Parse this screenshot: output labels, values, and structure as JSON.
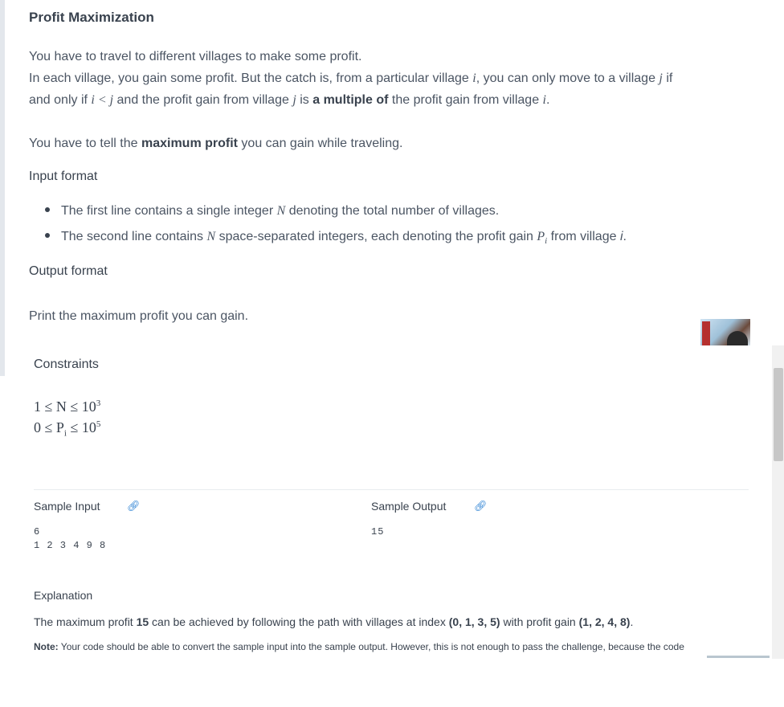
{
  "problem": {
    "title": "Profit Maximization",
    "intro_line1": "You have to travel to different villages to make some profit.",
    "intro_line2": {
      "a": "In each village, you gain some profit. But the catch is, from a particular village ",
      "i": "i",
      "b": ", you can only move to a village ",
      "j": "j",
      "c": " if"
    },
    "intro_line3": {
      "a": "and only if ",
      "math": "i < j",
      "b": " and the profit gain from village ",
      "j": "j",
      "c": " is ",
      "bold": "a multiple of",
      "d": " the profit gain from village ",
      "i": "i",
      "e": "."
    },
    "task_line": {
      "a": "You have to tell the ",
      "bold": "maximum profit",
      "b": " you can gain while traveling."
    },
    "input_heading": "Input format",
    "input_bullets": [
      {
        "a": "The first line contains a single integer ",
        "var": "N",
        "b": " denoting the total number of villages."
      },
      {
        "a": "The second line contains ",
        "var": "N",
        "b": " space-separated integers, each denoting the profit gain ",
        "var2": "P",
        "sub2": "i",
        "c": " from village ",
        "var3": "i",
        "d": "."
      }
    ],
    "output_heading": "Output format",
    "output_text": "Print the maximum profit you can gain.",
    "constraints_heading": "Constraints",
    "constraint1": {
      "lhs": "1 ≤ N ≤ 10",
      "exp": "3"
    },
    "constraint2": {
      "lhs_a": "0 ≤ P",
      "sub": "i",
      "lhs_b": " ≤ 10",
      "exp": "5"
    }
  },
  "samples": {
    "input_label": "Sample Input",
    "output_label": "Sample Output",
    "link_icon": "link-icon",
    "input_lines": [
      "6",
      "1 2 3 4 9 8"
    ],
    "output_lines": [
      "15"
    ]
  },
  "explanation": {
    "heading": "Explanation",
    "text": {
      "a": "The maximum profit ",
      "b1": "15",
      "c": " can be achieved by following the path with villages at index ",
      "b2": "(0, 1, 3, 5)",
      "d": " with profit gain ",
      "b3": "(1, 2, 4, 8)",
      "e": "."
    },
    "note_label": "Note:",
    "note_text": " Your code should be able to convert the sample input into the sample output. However, this is not enough to pass the challenge, because the code"
  },
  "colors": {
    "link": "#1f7ad1",
    "text": "#39424e",
    "muted": "#4b5563"
  }
}
